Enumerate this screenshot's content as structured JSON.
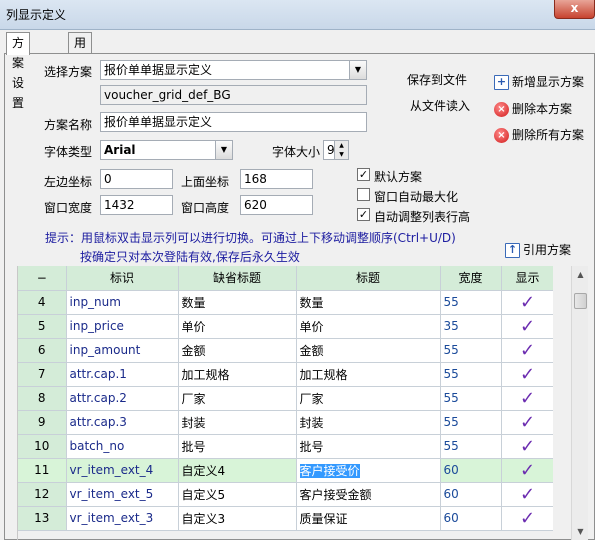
{
  "window": {
    "title": "列显示定义",
    "close_glyph": "x"
  },
  "tabs": [
    {
      "label": "方案设置",
      "active": true
    },
    {
      "label": "用户绑定",
      "active": false
    }
  ],
  "form": {
    "scheme_label": "选择方案",
    "scheme_value": "报价单单据显示定义",
    "scheme_code": "voucher_grid_def_BG",
    "name_label": "方案名称",
    "name_value": "报价单单据显示定义",
    "font_type_label": "字体类型",
    "font_type_value": "Arial",
    "font_size_label": "字体大小",
    "font_size_value": "9",
    "left_label": "左边坐标",
    "left_value": "0",
    "top_label": "上面坐标",
    "top_value": "168",
    "width_label": "窗口宽度",
    "width_value": "1432",
    "height_label": "窗口高度",
    "height_value": "620"
  },
  "checkboxes": [
    {
      "label": "默认方案",
      "checked": true
    },
    {
      "label": "窗口自动最大化",
      "checked": false
    },
    {
      "label": "自动调整列表行高",
      "checked": true
    }
  ],
  "actions": {
    "save_to_file": "保存到文件",
    "load_from_file": "从文件读入",
    "new_scheme": "新增显示方案",
    "delete_scheme": "删除本方案",
    "delete_all": "删除所有方案",
    "ref_scheme": "引用方案"
  },
  "hint": {
    "line1": "提示：用鼠标双击显示列可以进行切换。可通过上下移动调整顺序(Ctrl+U/D)",
    "line2": "按确定只对本次登陆有效,保存后永久生效"
  },
  "grid": {
    "columns": [
      "−",
      "标识",
      "缺省标题",
      "标题",
      "宽度",
      "显示"
    ],
    "rows": [
      {
        "idx": "4",
        "id": "inp_num",
        "default_title": "数量",
        "title": "数量",
        "width": "55",
        "show": "✓"
      },
      {
        "idx": "5",
        "id": "inp_price",
        "default_title": "单价",
        "title": "单价",
        "width": "35",
        "show": "✓"
      },
      {
        "idx": "6",
        "id": "inp_amount",
        "default_title": "金额",
        "title": "金额",
        "width": "55",
        "show": "✓"
      },
      {
        "idx": "7",
        "id": "attr.cap.1",
        "default_title": "加工规格",
        "title": "加工规格",
        "width": "55",
        "show": "✓"
      },
      {
        "idx": "8",
        "id": "attr.cap.2",
        "default_title": "厂家",
        "title": "厂家",
        "width": "55",
        "show": "✓"
      },
      {
        "idx": "9",
        "id": "attr.cap.3",
        "default_title": "封装",
        "title": "封装",
        "width": "55",
        "show": "✓"
      },
      {
        "idx": "10",
        "id": "batch_no",
        "default_title": "批号",
        "title": "批号",
        "width": "55",
        "show": "✓"
      },
      {
        "idx": "11",
        "id": "vr_item_ext_4",
        "default_title": "自定义4",
        "title": "客户接受价",
        "width": "60",
        "show": "✓",
        "selected": true
      },
      {
        "idx": "12",
        "id": "vr_item_ext_5",
        "default_title": "自定义5",
        "title": "客户接受金额",
        "width": "60",
        "show": "✓"
      },
      {
        "idx": "13",
        "id": "vr_item_ext_3",
        "default_title": "自定义3",
        "title": "质量保证",
        "width": "60",
        "show": "✓"
      }
    ]
  },
  "icons": {
    "dropdown": "chevron-down-icon",
    "check": "check-icon",
    "new": "new-doc-icon",
    "delete": "delete-icon"
  }
}
